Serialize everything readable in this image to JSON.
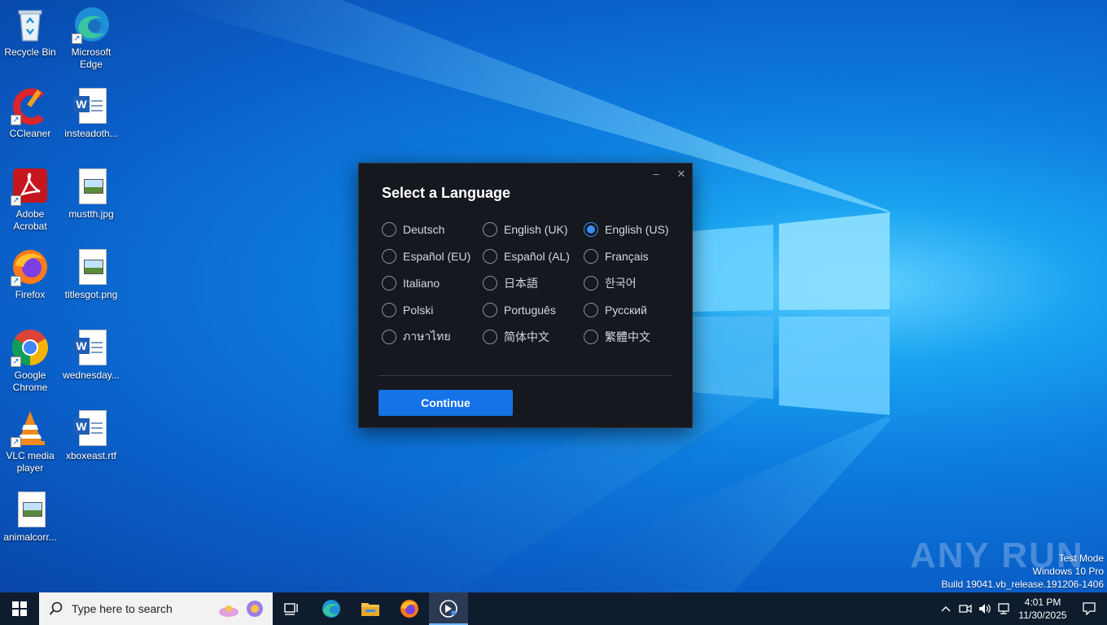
{
  "desktop_icons": [
    {
      "label": "Recycle Bin",
      "icon": "recycle-bin-icon"
    },
    {
      "label": "Microsoft Edge",
      "icon": "edge-icon"
    },
    {
      "label": "CCleaner",
      "icon": "ccleaner-icon"
    },
    {
      "label": "insteadoth...",
      "icon": "word-document-icon"
    },
    {
      "label": "Adobe Acrobat",
      "icon": "acrobat-icon"
    },
    {
      "label": "mustth.jpg",
      "icon": "image-file-icon"
    },
    {
      "label": "Firefox",
      "icon": "firefox-icon"
    },
    {
      "label": "titlesgot.png",
      "icon": "image-file-icon"
    },
    {
      "label": "Google Chrome",
      "icon": "chrome-icon"
    },
    {
      "label": "wednesday...",
      "icon": "word-document-icon"
    },
    {
      "label": "VLC media player",
      "icon": "vlc-icon"
    },
    {
      "label": "xboxeast.rtf",
      "icon": "word-document-icon"
    },
    {
      "label": "animalcorr...",
      "icon": "image-file-icon"
    }
  ],
  "dialog": {
    "title": "Select a Language",
    "minimize_glyph": "–",
    "close_glyph": "✕",
    "languages": [
      {
        "label": "Deutsch",
        "selected": false
      },
      {
        "label": "English (UK)",
        "selected": false
      },
      {
        "label": "English (US)",
        "selected": true
      },
      {
        "label": "Español (EU)",
        "selected": false
      },
      {
        "label": "Español (AL)",
        "selected": false
      },
      {
        "label": "Français",
        "selected": false
      },
      {
        "label": "Italiano",
        "selected": false
      },
      {
        "label": "日本語",
        "selected": false
      },
      {
        "label": "한국어",
        "selected": false
      },
      {
        "label": "Polski",
        "selected": false
      },
      {
        "label": "Português",
        "selected": false
      },
      {
        "label": "Русский",
        "selected": false
      },
      {
        "label": "ภาษาไทย",
        "selected": false
      },
      {
        "label": "简体中文",
        "selected": false
      },
      {
        "label": "繁體中文",
        "selected": false
      }
    ],
    "continue_label": "Continue",
    "accent_color": "#1473e6"
  },
  "watermark": {
    "text": "ANY RUN",
    "test_mode": "Test Mode",
    "edition": "Windows 10 Pro",
    "build": "Build 19041.vb_release.191206-1406"
  },
  "taskbar": {
    "search_placeholder": "Type here to search",
    "pinned": [
      "task-view-icon",
      "edge-icon",
      "file-explorer-icon",
      "firefox-icon",
      "app-installer-icon"
    ],
    "clock_time": "4:01 PM",
    "clock_date": "11/30/2025"
  }
}
